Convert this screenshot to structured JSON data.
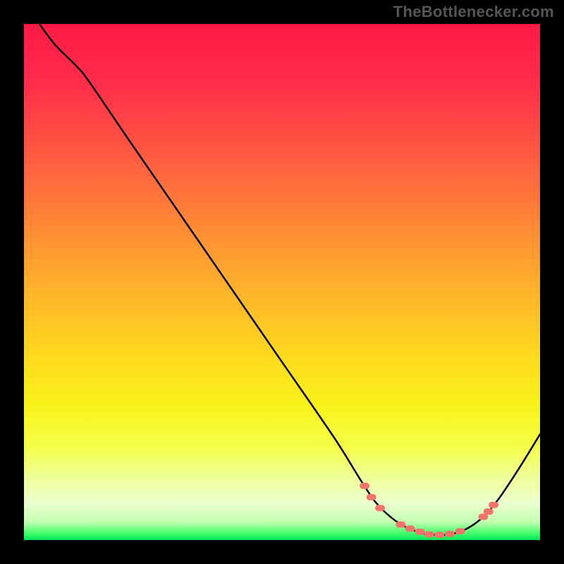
{
  "attribution": "TheBottlenecker.com",
  "chart_data": {
    "type": "line",
    "title": "",
    "xlabel": "",
    "ylabel": "",
    "xlim": [
      0,
      100
    ],
    "ylim": [
      0,
      100
    ],
    "grid": false,
    "legend": false,
    "gradient": {
      "stops": [
        {
          "pos": 0.0,
          "color": "#ff1a46"
        },
        {
          "pos": 0.12,
          "color": "#ff2e4a"
        },
        {
          "pos": 0.3,
          "color": "#ff6a3e"
        },
        {
          "pos": 0.48,
          "color": "#ffa72e"
        },
        {
          "pos": 0.64,
          "color": "#ffd91f"
        },
        {
          "pos": 0.74,
          "color": "#f8f21a"
        },
        {
          "pos": 0.82,
          "color": "#f4ff4a"
        },
        {
          "pos": 0.88,
          "color": "#f0ff9a"
        },
        {
          "pos": 0.93,
          "color": "#eaffcf"
        },
        {
          "pos": 0.965,
          "color": "#c3ffb0"
        },
        {
          "pos": 0.985,
          "color": "#4dff70"
        },
        {
          "pos": 1.0,
          "color": "#00e85a"
        }
      ]
    },
    "curve": {
      "comment": "bottleneck curve; x is a normalized hardware ratio axis, y is bottleneck percentage (0 = ideal)",
      "points": [
        {
          "x": 3.0,
          "y": 100.0
        },
        {
          "x": 6.0,
          "y": 96.0
        },
        {
          "x": 10.0,
          "y": 92.0
        },
        {
          "x": 12.5,
          "y": 89.0
        },
        {
          "x": 20.0,
          "y": 78.0
        },
        {
          "x": 30.0,
          "y": 63.5
        },
        {
          "x": 40.0,
          "y": 49.0
        },
        {
          "x": 50.0,
          "y": 34.5
        },
        {
          "x": 60.0,
          "y": 20.0
        },
        {
          "x": 65.0,
          "y": 12.0
        },
        {
          "x": 68.0,
          "y": 7.5
        },
        {
          "x": 71.0,
          "y": 4.5
        },
        {
          "x": 74.0,
          "y": 2.5
        },
        {
          "x": 77.0,
          "y": 1.4
        },
        {
          "x": 80.0,
          "y": 1.0
        },
        {
          "x": 83.0,
          "y": 1.2
        },
        {
          "x": 86.0,
          "y": 2.3
        },
        {
          "x": 89.0,
          "y": 4.5
        },
        {
          "x": 92.0,
          "y": 8.0
        },
        {
          "x": 96.0,
          "y": 14.0
        },
        {
          "x": 100.0,
          "y": 20.5
        }
      ]
    },
    "markers": {
      "comment": "salmon dashed markers near the minimum",
      "color": "#f2756b",
      "points": [
        {
          "x": 66.0,
          "y": 10.5
        },
        {
          "x": 67.3,
          "y": 8.3
        },
        {
          "x": 69.0,
          "y": 6.2
        },
        {
          "x": 73.0,
          "y": 3.0
        },
        {
          "x": 74.8,
          "y": 2.2
        },
        {
          "x": 76.7,
          "y": 1.6
        },
        {
          "x": 78.5,
          "y": 1.1
        },
        {
          "x": 80.5,
          "y": 1.0
        },
        {
          "x": 82.5,
          "y": 1.2
        },
        {
          "x": 84.5,
          "y": 1.7
        },
        {
          "x": 89.0,
          "y": 4.5
        },
        {
          "x": 90.0,
          "y": 5.5
        },
        {
          "x": 91.0,
          "y": 6.8
        }
      ]
    }
  }
}
